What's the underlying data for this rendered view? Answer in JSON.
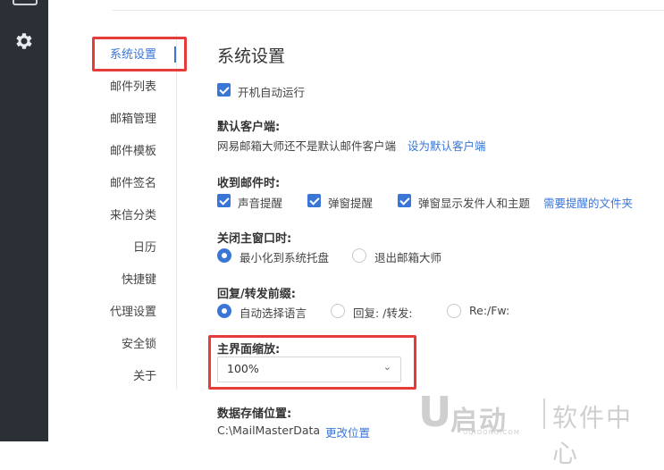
{
  "colors": {
    "accent": "#3a76d6",
    "highlight": "#e53b3b",
    "rail": "#2b2f36"
  },
  "rail": {
    "icon": "gear-icon"
  },
  "menu": {
    "items": [
      {
        "label": "系统设置",
        "active": true
      },
      {
        "label": "邮件列表"
      },
      {
        "label": "邮箱管理"
      },
      {
        "label": "邮件模板"
      },
      {
        "label": "邮件签名"
      },
      {
        "label": "来信分类"
      },
      {
        "label": "日历"
      },
      {
        "label": "快捷键"
      },
      {
        "label": "代理设置"
      },
      {
        "label": "安全锁"
      },
      {
        "label": "关于"
      }
    ]
  },
  "main": {
    "title": "系统设置",
    "autostart": {
      "label": "开机自动运行",
      "checked": true
    },
    "default_client": {
      "title": "默认客户端:",
      "status": "网易邮箱大师还不是默认邮件客户端",
      "link": "设为默认客户端"
    },
    "on_receive": {
      "title": "收到邮件时:",
      "options": [
        {
          "label": "声音提醒",
          "checked": true
        },
        {
          "label": "弹窗提醒",
          "checked": true
        },
        {
          "label": "弹窗显示发件人和主题",
          "checked": true
        }
      ],
      "link": "需要提醒的文件夹"
    },
    "close_window": {
      "title": "关闭主窗口时:",
      "options": [
        {
          "label": "最小化到系统托盘",
          "selected": true
        },
        {
          "label": "退出邮箱大师",
          "selected": false
        }
      ]
    },
    "reply_prefix": {
      "title": "回复/转发前缀:",
      "options": [
        {
          "label": "自动选择语言",
          "selected": true
        },
        {
          "label": "回复:  /转发:",
          "selected": false
        },
        {
          "label": "Re:/Fw:",
          "selected": false
        }
      ]
    },
    "zoom": {
      "title": "主界面缩放:",
      "value": "100%"
    },
    "storage": {
      "title": "数据存储位置:",
      "path": "C:\\MailMasterData",
      "link": "更改位置"
    }
  },
  "watermark": {
    "letter": "U",
    "brand": "启动",
    "right": "软件中心",
    "small": "UQIDONG.COM"
  }
}
